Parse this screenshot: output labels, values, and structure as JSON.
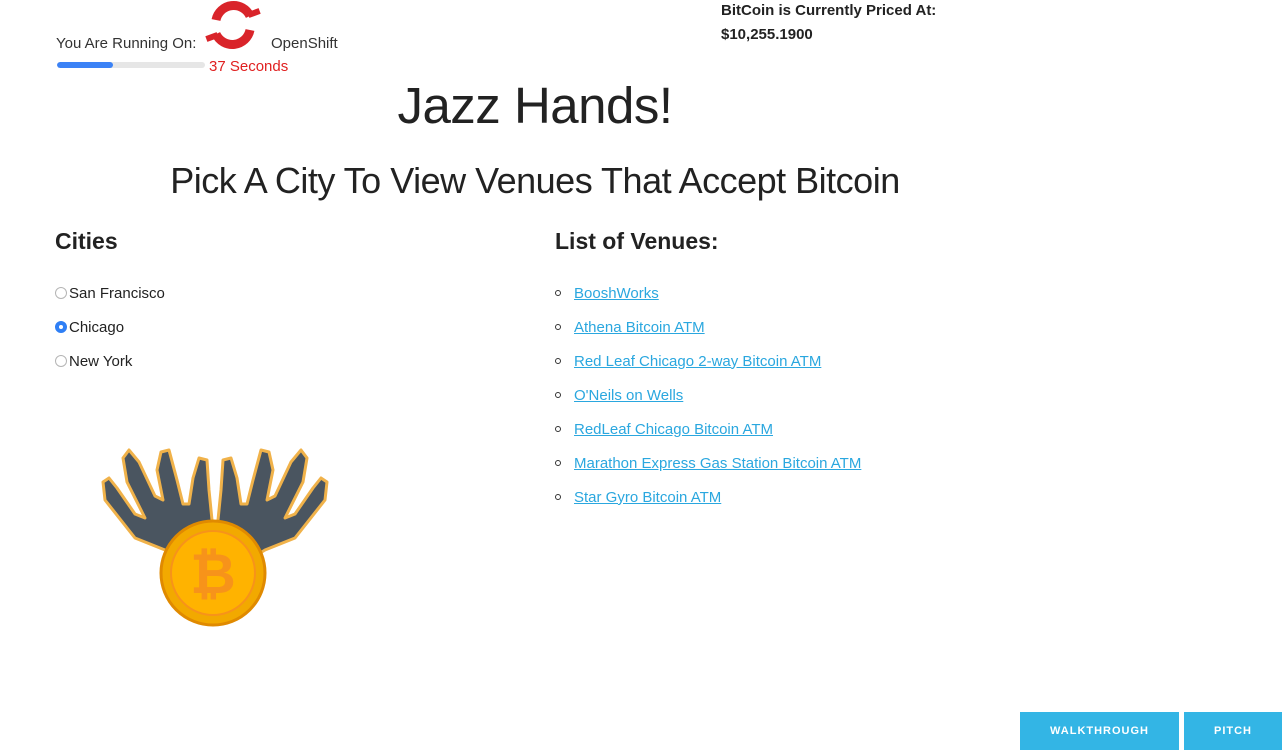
{
  "runtime": {
    "label": "You Are Running On:",
    "platform_name": "OpenShift",
    "platform_icon": "openshift-logo",
    "timer": "37 Seconds",
    "progress": 0.38
  },
  "price": {
    "label": "BitCoin is Currently Priced At:",
    "value": "$10,255.1900"
  },
  "title": "Jazz Hands!",
  "subtitle": "Pick A City To View Venues That Accept Bitcoin",
  "cities": {
    "heading": "Cities",
    "items": [
      {
        "label": "San Francisco",
        "selected": false
      },
      {
        "label": "Chicago",
        "selected": true
      },
      {
        "label": "New York",
        "selected": false
      }
    ]
  },
  "venues": {
    "heading": "List of Venues:",
    "items": [
      {
        "label": "BooshWorks"
      },
      {
        "label": "Athena Bitcoin ATM"
      },
      {
        "label": "Red Leaf Chicago 2-way Bitcoin ATM"
      },
      {
        "label": "O'Neils on Wells"
      },
      {
        "label": "RedLeaf Chicago Bitcoin ATM"
      },
      {
        "label": "Marathon Express Gas Station Bitcoin ATM"
      },
      {
        "label": "Star Gyro Bitcoin ATM"
      }
    ]
  },
  "hero_image": "jazz-hands-bitcoin-logo",
  "buttons": {
    "walkthrough": "WALKTHROUGH",
    "pitch": "PITCH"
  },
  "colors": {
    "accent_blue": "#33b5e5",
    "link": "#2aa7df",
    "timer_red": "#e02020",
    "progress_blue": "#3b82f6",
    "openshift_red": "#d9242a",
    "bitcoin_orange": "#f7931a"
  }
}
